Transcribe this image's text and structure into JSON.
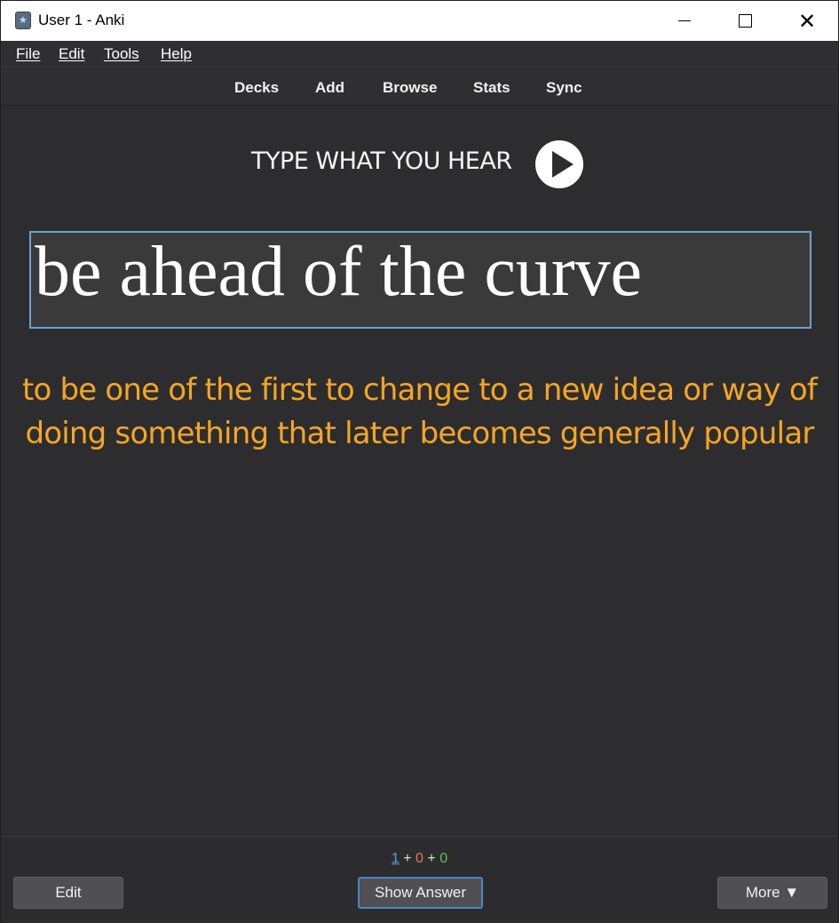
{
  "window": {
    "title": "User 1 - Anki",
    "controls": {
      "minimize": "minimize",
      "maximize": "maximize",
      "close": "✕"
    }
  },
  "menubar": {
    "items": [
      "File",
      "Edit",
      "Tools",
      "Help"
    ]
  },
  "toolbar": {
    "items": [
      "Decks",
      "Add",
      "Browse",
      "Stats",
      "Sync"
    ]
  },
  "card": {
    "prompt": "TYPE WHAT YOU HEAR",
    "typed_answer": "be ahead of the curve",
    "definition": "to be one of the first to change to a new idea or way of doing something that later becomes generally popular"
  },
  "counts": {
    "new": "1",
    "sep1": "+",
    "learn": "0",
    "sep2": "+",
    "review": "0"
  },
  "buttons": {
    "edit": "Edit",
    "show_answer": "Show Answer",
    "more": "More ▼"
  },
  "colors": {
    "background": "#2d2d2f",
    "definition": "#f5a623",
    "new_count": "#5a9fe0",
    "learn_count": "#e07a5a",
    "review_count": "#5ec35e",
    "focus_border": "#4a86c8"
  }
}
